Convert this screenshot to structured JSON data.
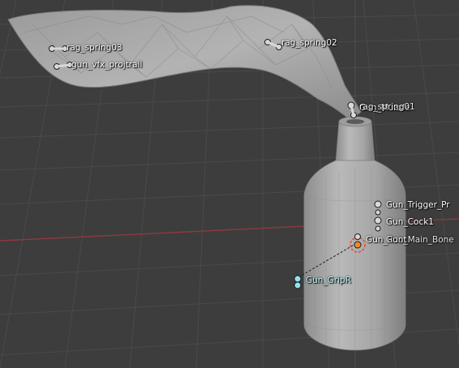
{
  "viewport": {
    "background": "#3d3d3d",
    "grid_color": "#4a4a4a",
    "x_axis_color": "#8a3a3e",
    "mesh_color": "#a9a9a9",
    "bone_color": "#d8d8d8",
    "selected_bone_color": "#8fe3ea",
    "active_bone_color": "#f28a2c"
  },
  "bones": [
    {
      "label": "rag_spring03"
    },
    {
      "label": "gun_vfx_projtrail"
    },
    {
      "label": "rag_spring02"
    },
    {
      "label": "Gun_Muzzle"
    },
    {
      "label": "rag_spring01"
    },
    {
      "label": "Gun_Trigger_Pr"
    },
    {
      "label": "Gun_Cock1"
    },
    {
      "label": "Gun_Root"
    },
    {
      "label": "Gun_Main_Bone"
    },
    {
      "label": "Gun_GripR"
    }
  ]
}
